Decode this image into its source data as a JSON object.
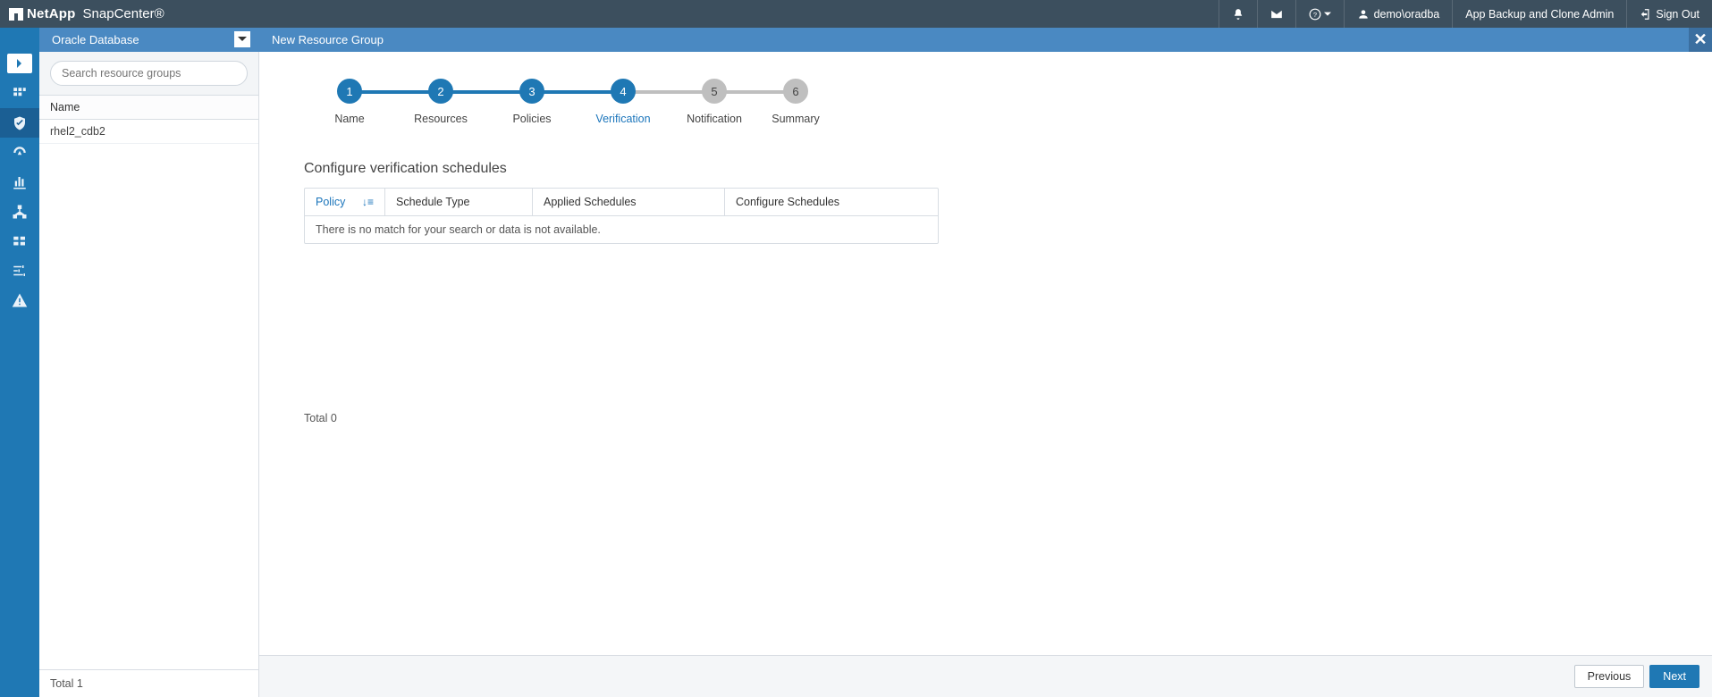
{
  "topbar": {
    "brand_company": "NetApp",
    "brand_product": "SnapCenter®",
    "user_label": "demo\\oradba",
    "role_label": "App Backup and Clone Admin",
    "signout_label": "Sign Out"
  },
  "context": {
    "db_type": "Oracle Database",
    "wizard_title": "New Resource Group"
  },
  "resources": {
    "search_placeholder": "Search resource groups",
    "column_name": "Name",
    "rows": [
      "rhel2_cdb2"
    ],
    "total_label": "Total 1"
  },
  "stepper": {
    "steps": [
      {
        "num": "1",
        "label": "Name",
        "state": "done"
      },
      {
        "num": "2",
        "label": "Resources",
        "state": "done"
      },
      {
        "num": "3",
        "label": "Policies",
        "state": "done"
      },
      {
        "num": "4",
        "label": "Verification",
        "state": "current"
      },
      {
        "num": "5",
        "label": "Notification",
        "state": "pending"
      },
      {
        "num": "6",
        "label": "Summary",
        "state": "pending"
      }
    ]
  },
  "verification": {
    "section_title": "Configure verification schedules",
    "col_policy": "Policy",
    "col_schedtype": "Schedule Type",
    "col_applied": "Applied Schedules",
    "col_config": "Configure Schedules",
    "empty_message": "There is no match for your search or data is not available.",
    "total_label": "Total 0"
  },
  "footer": {
    "previous": "Previous",
    "next": "Next"
  }
}
